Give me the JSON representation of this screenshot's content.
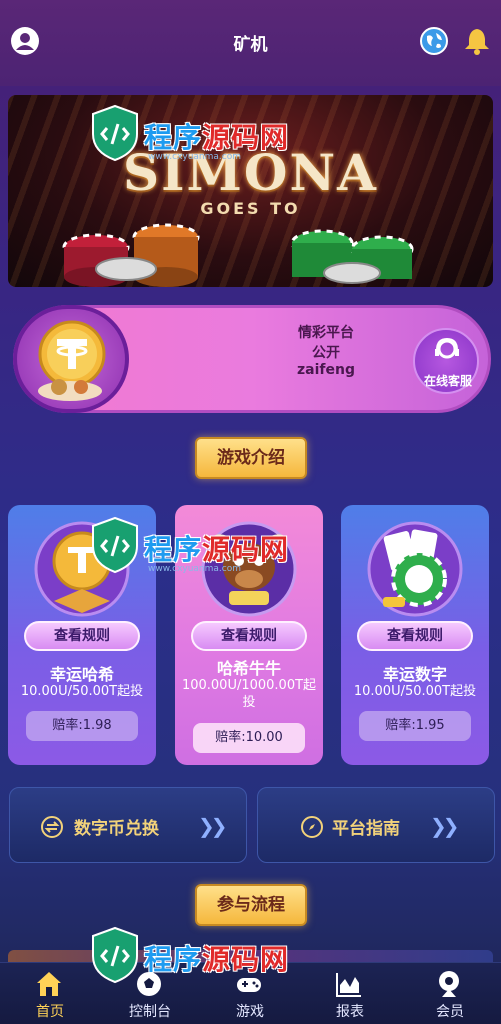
{
  "header": {
    "title": "矿机"
  },
  "banner": {
    "title": "SIMONA",
    "subtitle": "GOES TO"
  },
  "info": {
    "line1": "情彩平台",
    "line2": "公开",
    "line3": "zaifeng",
    "service_label": "在线客服"
  },
  "sections": {
    "games_title": "游戏介绍",
    "process_title": "参与流程"
  },
  "games": [
    {
      "rule_label": "查看规则",
      "name": "幸运哈希",
      "range": "10.00U/50.00T起投",
      "rate": "赔率:1.98"
    },
    {
      "rule_label": "查看规则",
      "name": "哈希牛牛",
      "range": "100.00U/1000.00T起投",
      "rate": "赔率:10.00"
    },
    {
      "rule_label": "查看规则",
      "name": "幸运数字",
      "range": "10.00U/50.00T起投",
      "rate": "赔率:1.95"
    }
  ],
  "actions": {
    "exchange_label": "数字币兑换",
    "guide_label": "平台指南"
  },
  "tabs": [
    {
      "label": "首页",
      "icon": "home-icon"
    },
    {
      "label": "控制台",
      "icon": "soccer-ball-icon"
    },
    {
      "label": "游戏",
      "icon": "gamepad-icon"
    },
    {
      "label": "报表",
      "icon": "chart-icon"
    },
    {
      "label": "会员",
      "icon": "member-icon"
    }
  ],
  "watermark": {
    "text_blue": "程序",
    "text_red": "源码网",
    "url": "www.cxyuanma.com"
  },
  "colors": {
    "accent_gold": "#f2d27a",
    "active_tab": "#ffd257",
    "usdt_green": "#26a17b"
  }
}
